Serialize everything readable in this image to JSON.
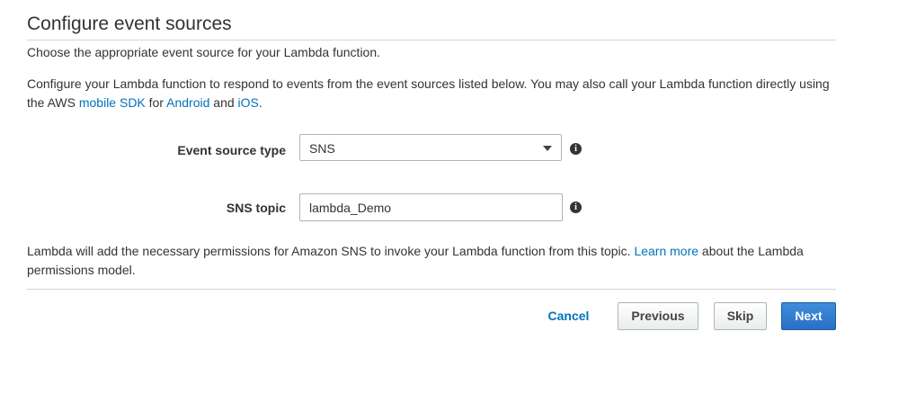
{
  "page": {
    "title": "Configure event sources",
    "subtitle": "Choose the appropriate event source for your Lambda function."
  },
  "description": {
    "text_1": "Configure your Lambda function to respond to events from the event sources listed below. You may also call your Lambda function directly using the AWS ",
    "link_mobile_sdk": "mobile SDK",
    "text_2": " for ",
    "link_android": "Android",
    "text_3": " and ",
    "link_ios": "iOS",
    "text_4": "."
  },
  "form": {
    "event_source_type": {
      "label": "Event source type",
      "value": "SNS",
      "info_icon": "info-icon"
    },
    "sns_topic": {
      "label": "SNS topic",
      "value": "lambda_Demo",
      "info_icon": "info-icon"
    }
  },
  "permissions_note": {
    "text_1": "Lambda will add the necessary permissions for Amazon SNS to invoke your Lambda function from this topic. ",
    "link_learn_more": "Learn more",
    "text_2": " about the Lambda permissions model."
  },
  "buttons": {
    "cancel": "Cancel",
    "previous": "Previous",
    "skip": "Skip",
    "next": "Next"
  },
  "colors": {
    "link": "#0073bb",
    "primary_button": "#2a70c4",
    "text": "#333333",
    "border": "#aab7b8"
  }
}
